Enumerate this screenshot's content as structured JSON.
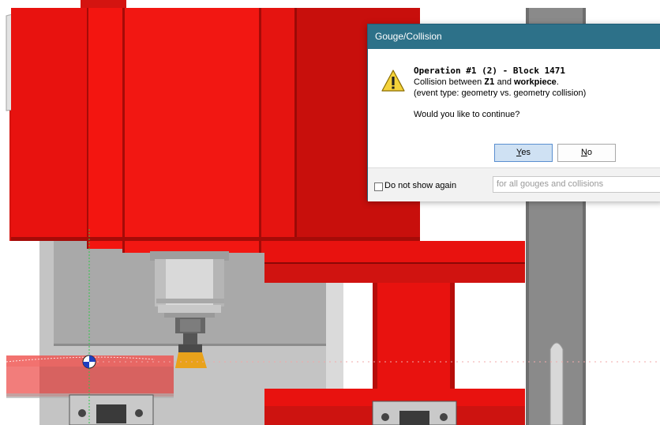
{
  "dialog": {
    "title": "Gouge/Collision",
    "operation_line": "Operation #1 (2) - Block 1471",
    "collision_prefix": "Collision between ",
    "collision_obj1": "Z1",
    "collision_and": " and ",
    "collision_obj2": "workpiece",
    "collision_suffix": ".",
    "event_type": "(event type: geometry vs. geometry collision)",
    "question": "Would you like to continue?",
    "yes_label_underlined": "Y",
    "yes_label_rest": "es",
    "no_label_underlined": "N",
    "no_label_rest": "o",
    "dont_show_label": "Do not show again",
    "scope_value": "for all gouges and collisions",
    "dont_show_checked": false
  },
  "icons": {
    "warning": "warning-icon",
    "coordinate_marker": "workpiece-origin-icon"
  },
  "colors": {
    "machine_red": "#e8120f",
    "title_bar": "#2d7189",
    "tool_gold": "#e9a21b",
    "housing_gray": "#bdbdbd"
  }
}
